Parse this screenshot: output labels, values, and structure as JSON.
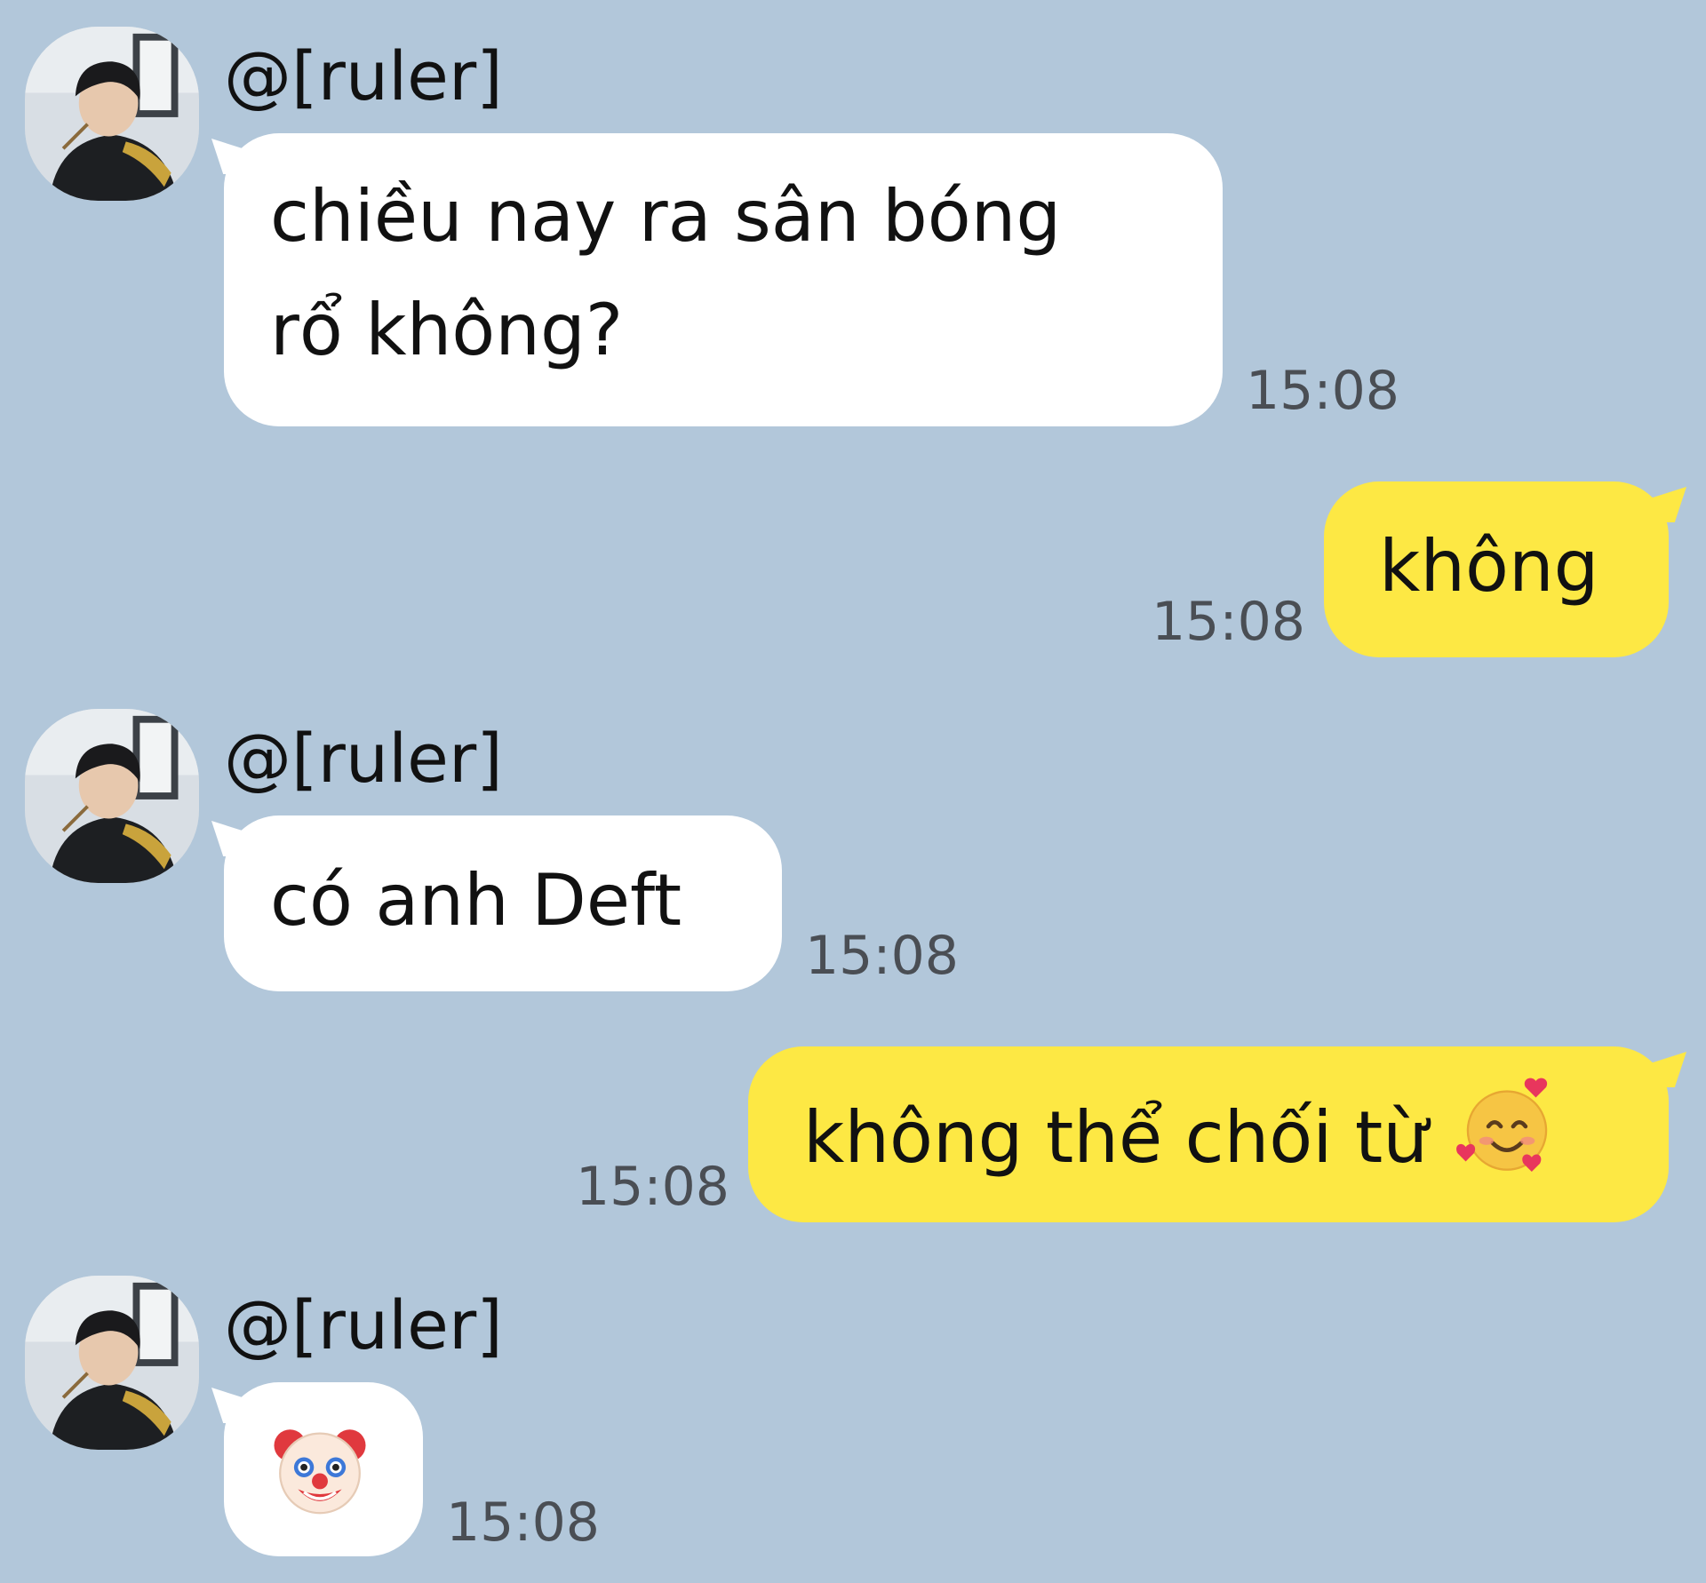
{
  "colors": {
    "background": "#b2c7da",
    "incoming_bubble": "#ffffff",
    "outgoing_bubble": "#fde844",
    "timestamp": "#4a4e54"
  },
  "messages": [
    {
      "direction": "incoming",
      "sender": "@[ruler]",
      "lines": [
        "chiều nay ra sân bóng",
        "rổ không?"
      ],
      "time": "15:08"
    },
    {
      "direction": "outgoing",
      "text": "không",
      "time": "15:08"
    },
    {
      "direction": "incoming",
      "sender": "@[ruler]",
      "text": "có anh Deft",
      "time": "15:08"
    },
    {
      "direction": "outgoing",
      "text": "không thể chối từ",
      "emoji": "smiling-face-with-hearts-icon",
      "time": "15:08"
    },
    {
      "direction": "incoming",
      "sender": "@[ruler]",
      "emoji": "clown-face-icon",
      "time": "15:08"
    }
  ]
}
